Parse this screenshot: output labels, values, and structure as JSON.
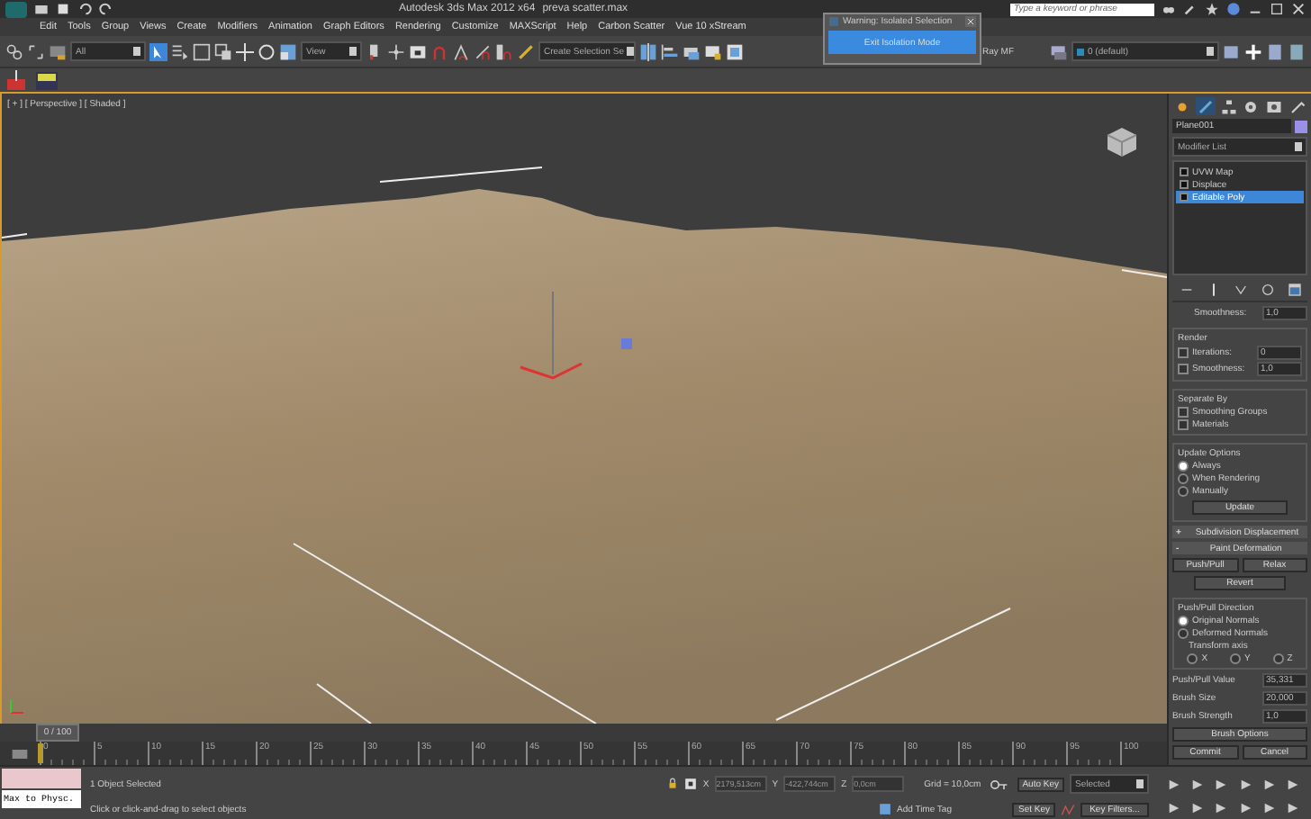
{
  "title_bar": {
    "app_title": "Autodesk 3ds Max  2012 x64",
    "file_name": "preva scatter.max",
    "search_placeholder": "Type a keyword or phrase"
  },
  "menu": [
    "Edit",
    "Tools",
    "Group",
    "Views",
    "Create",
    "Modifiers",
    "Animation",
    "Graph Editors",
    "Rendering",
    "Customize",
    "MAXScript",
    "Help",
    "Carbon Scatter",
    "Vue 10 xStream"
  ],
  "main_toolbar": {
    "selection_filter": "All",
    "reference_coord": "View",
    "named_selection": "Create Selection Se",
    "ray_label": "Ray MF",
    "layer": "0 (default)"
  },
  "isolate_dialog": {
    "title": "Warning: Isolated Selection",
    "button": "Exit Isolation Mode"
  },
  "viewport": {
    "label": "[ + ] [ Perspective ] [ Shaded ]"
  },
  "command_panel": {
    "tabs": [
      {
        "selected": false
      },
      {
        "selected": true
      },
      {
        "selected": false
      },
      {
        "selected": false
      },
      {
        "selected": false
      },
      {
        "selected": false
      }
    ],
    "object_name": "Plane001",
    "modifier_list": "Modifier List",
    "stack": [
      {
        "label": "UVW Map",
        "selected": false
      },
      {
        "label": "Displace",
        "selected": false
      },
      {
        "label": "Editable Poly",
        "selected": true
      }
    ],
    "smoothness": {
      "label": "Smoothness:",
      "value": "1,0"
    },
    "render_group": {
      "title": "Render",
      "rows": [
        {
          "label": "Iterations:",
          "value": "0",
          "checked": false
        },
        {
          "label": "Smoothness:",
          "value": "1,0",
          "checked": false
        }
      ]
    },
    "separate_by": {
      "title": "Separate By",
      "options": [
        {
          "label": "Smoothing Groups",
          "checked": false
        },
        {
          "label": "Materials",
          "checked": false
        }
      ]
    },
    "update_options": {
      "title": "Update Options",
      "options": [
        {
          "label": "Always",
          "selected": true
        },
        {
          "label": "When Rendering",
          "selected": false
        },
        {
          "label": "Manually",
          "selected": false
        }
      ],
      "button": "Update"
    },
    "rollouts": [
      {
        "sign": "+",
        "title": "Subdivision Displacement"
      },
      {
        "sign": "-",
        "title": "Paint Deformation"
      }
    ],
    "paint": {
      "buttons": [
        "Push/Pull",
        "Relax"
      ],
      "revert": "Revert",
      "direction_title": "Push/Pull Direction",
      "directions": [
        {
          "label": "Original Normals",
          "selected": true
        },
        {
          "label": "Deformed Normals",
          "selected": false
        }
      ],
      "transform_axis": "Transform axis",
      "axes": [
        {
          "label": "X",
          "selected": false
        },
        {
          "label": "Y",
          "selected": false
        },
        {
          "label": "Z",
          "selected": false
        }
      ],
      "fields": [
        {
          "label": "Push/Pull Value",
          "value": "35,331"
        },
        {
          "label": "Brush Size",
          "value": "20,000"
        },
        {
          "label": "Brush Strength",
          "value": "1,0"
        }
      ],
      "brush_options": "Brush Options",
      "commit": "Commit",
      "cancel": "Cancel"
    }
  },
  "timeline": {
    "frame": "0 / 100",
    "ticks": [
      "0",
      "5",
      "10",
      "15",
      "20",
      "25",
      "30",
      "35",
      "40",
      "45",
      "50",
      "55",
      "60",
      "65",
      "70",
      "75",
      "80",
      "85",
      "90",
      "95",
      "100"
    ]
  },
  "status_bar": {
    "listener": "Max to Physc.",
    "selection": "1 Object Selected",
    "prompt": "Click or click-and-drag to select objects",
    "coords": [
      {
        "axis": "X",
        "value": "2179,513cm"
      },
      {
        "axis": "Y",
        "value": "-422,744cm"
      },
      {
        "axis": "Z",
        "value": "0,0cm"
      }
    ],
    "grid": "Grid = 10,0cm",
    "time_tag": "Add Time Tag",
    "auto_key": "Auto Key",
    "key_mode": "Selected",
    "set_key": "Set Key",
    "key_filters": "Key Filters..."
  }
}
